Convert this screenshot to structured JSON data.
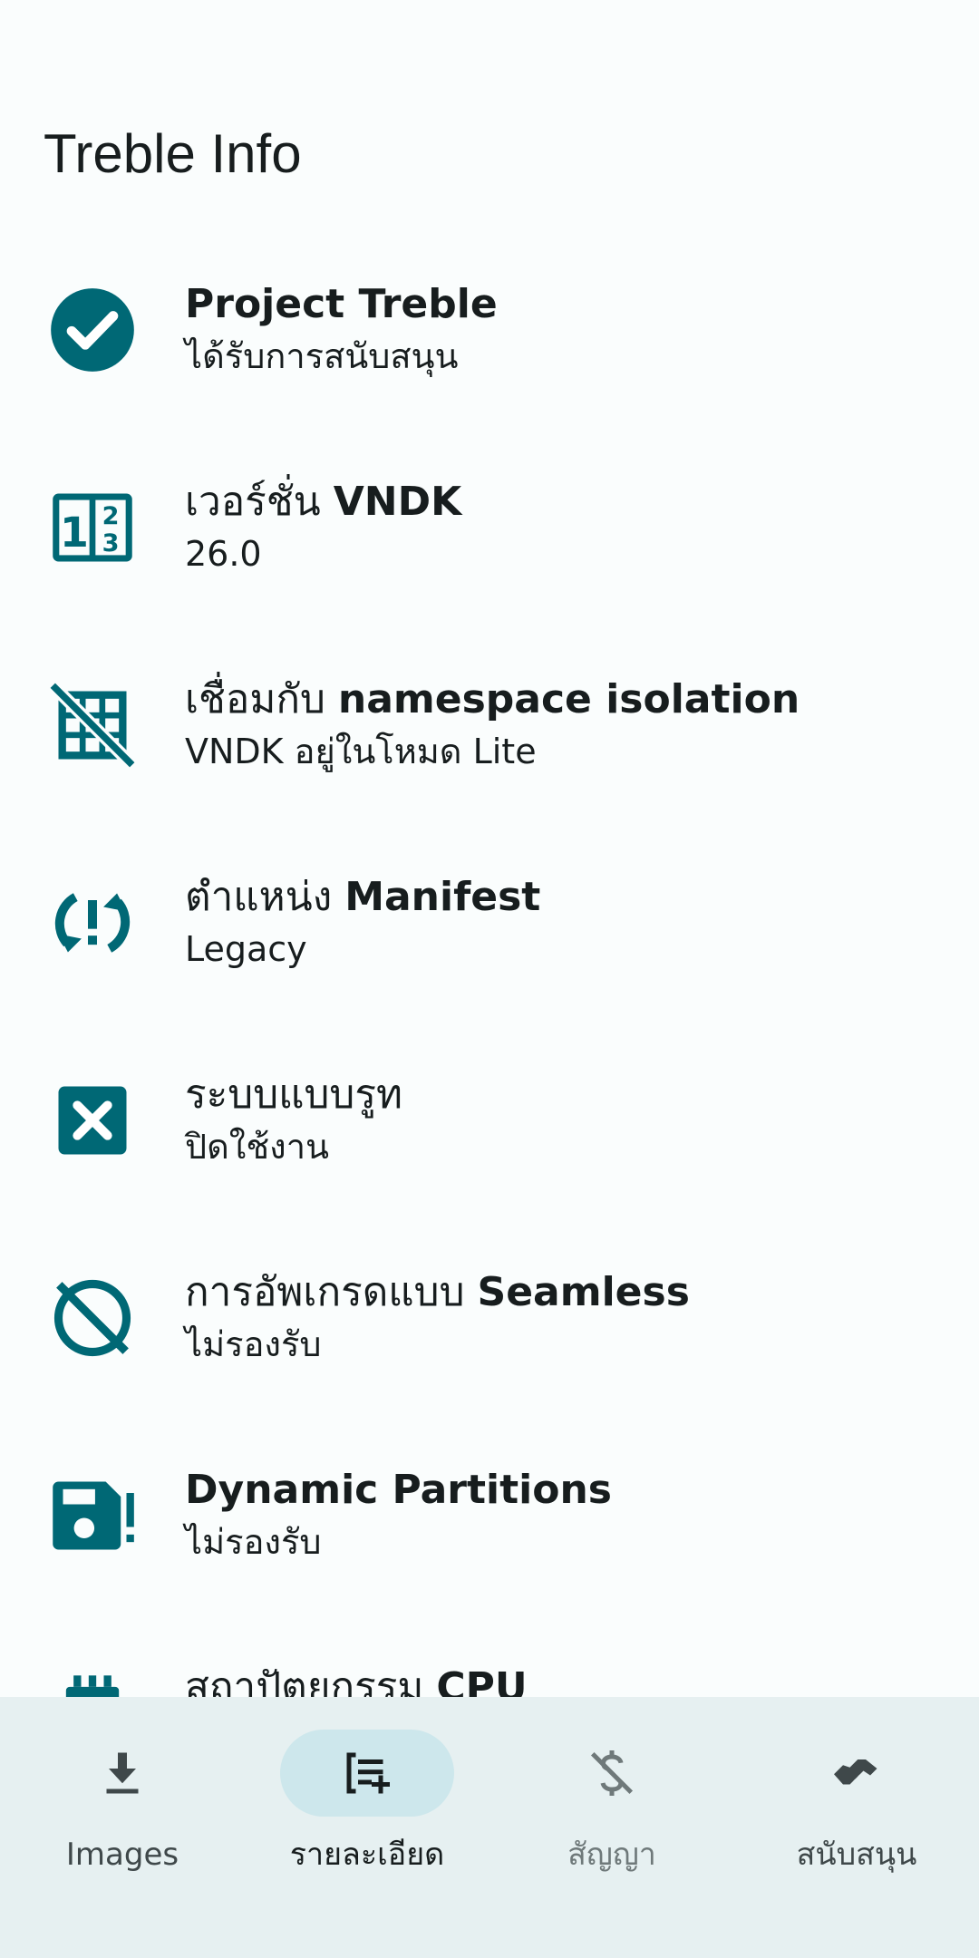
{
  "app": {
    "title": "Treble Info"
  },
  "colors": {
    "accent": "#006875",
    "background": "#fafdfd",
    "nav_background": "#e6f0f1",
    "nav_active_pill": "#cde7ec"
  },
  "items": [
    {
      "icon": "check-circle-icon",
      "title_prefix": "",
      "title_bold": "Project Treble",
      "subtitle": "ได้รับการสนับสนุน"
    },
    {
      "icon": "numbers-box-icon",
      "title_prefix": "เวอร์ชั่น ",
      "title_bold": "VNDK",
      "subtitle": "26.0"
    },
    {
      "icon": "grid-off-icon",
      "title_prefix": "เชื่อมกับ ",
      "title_bold": "namespace isolation",
      "subtitle": "VNDK อยู่ในโหมด Lite"
    },
    {
      "icon": "sync-problem-icon",
      "title_prefix": "ตำแหน่ง ",
      "title_bold": "Manifest",
      "subtitle": "Legacy"
    },
    {
      "icon": "close-box-icon",
      "title_prefix": "ระบบแบบรูท",
      "title_bold": "",
      "subtitle": "ปิดใช้งาน"
    },
    {
      "icon": "block-icon",
      "title_prefix": "การอัพเกรดแบบ ",
      "title_bold": "Seamless",
      "subtitle": "ไม่รองรับ"
    },
    {
      "icon": "save-alert-icon",
      "title_prefix": "",
      "title_bold": "Dynamic Partitions",
      "subtitle": "ไม่รองรับ"
    },
    {
      "icon": "cpu-chip-icon",
      "title_prefix": "สถาปัตยกรรม ",
      "title_bold": "CPU",
      "subtitle": ""
    }
  ],
  "nav": {
    "items": [
      {
        "label": "Images",
        "icon": "download-icon",
        "selected": false
      },
      {
        "label": "รายละเอียด",
        "icon": "playlist-add-icon",
        "selected": true
      },
      {
        "label": "สัญญา",
        "icon": "money-off-icon",
        "selected": false
      },
      {
        "label": "สนับสนุน",
        "icon": "handshake-icon",
        "selected": false
      }
    ]
  }
}
